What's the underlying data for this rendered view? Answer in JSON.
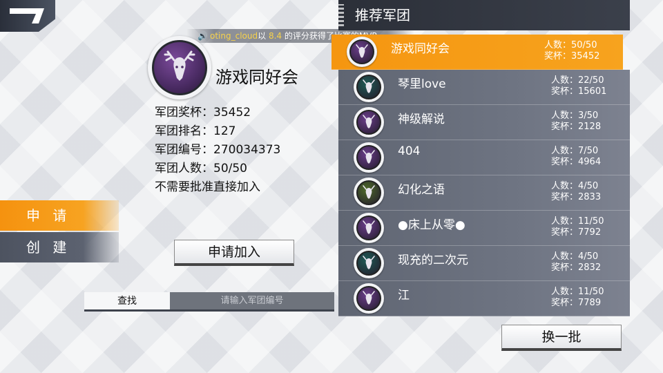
{
  "ticker": {
    "speaker_icon": "speaker-icon",
    "player": "oting_cloud",
    "text_a": "以 ",
    "score": "8.4",
    "text_b": " 的评分获得了比赛的MVP"
  },
  "profile": {
    "emblem_icon": "deer-emblem-icon",
    "name": "游戏同好会",
    "trophies": "军团奖杯：35452",
    "rank": "军团排名：127",
    "id": "军团编号：270034373",
    "members": "军团人数：50/50",
    "policy": "不需要批准直接加入"
  },
  "tabs": {
    "apply": "申 请",
    "create": "创 建"
  },
  "join_label": "申请加入",
  "search": {
    "tab_label": "查找",
    "placeholder": "请输入军团编号"
  },
  "recommend": {
    "title": "推荐军团",
    "refresh_label": "换一批",
    "items": [
      {
        "name": "游戏同好会",
        "members": "人数：50/50",
        "trophies": "奖杯：35452",
        "emblem": "deer-emblem-icon",
        "color": "#6a3d8a",
        "selected": true
      },
      {
        "name": "琴里love",
        "members": "人数：22/50",
        "trophies": "奖杯：15601",
        "emblem": "eagle-emblem-icon",
        "color": "#1f5a55",
        "selected": false
      },
      {
        "name": "神级解说",
        "members": "人数：3/50",
        "trophies": "奖杯：2128",
        "emblem": "deer-emblem-icon",
        "color": "#6a3d8a",
        "selected": false
      },
      {
        "name": "404",
        "members": "人数：7/50",
        "trophies": "奖杯：4964",
        "emblem": "wolf-emblem-icon",
        "color": "#6a3d8a",
        "selected": false
      },
      {
        "name": "幻化之语",
        "members": "人数：4/50",
        "trophies": "奖杯：2833",
        "emblem": "serpent-emblem-icon",
        "color": "#4e6a2a",
        "selected": false
      },
      {
        "name": "●床上从零●",
        "members": "人数：11/50",
        "trophies": "奖杯：7792",
        "emblem": "wolf-emblem-icon",
        "color": "#6a3d8a",
        "selected": false
      },
      {
        "name": "现充的二次元",
        "members": "人数：4/50",
        "trophies": "奖杯：2832",
        "emblem": "eagle-emblem-icon",
        "color": "#1f5a55",
        "selected": false
      },
      {
        "name": "江",
        "members": "人数：11/50",
        "trophies": "奖杯：7789",
        "emblem": "deer-emblem-icon",
        "color": "#6a3d8a",
        "selected": false
      }
    ]
  }
}
